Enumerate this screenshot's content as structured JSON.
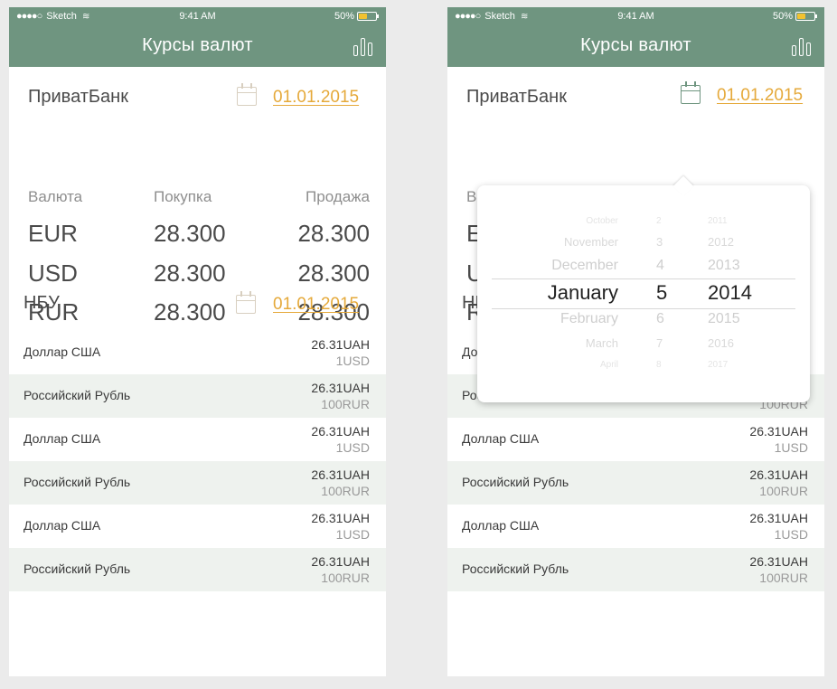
{
  "status_bar": {
    "dots": "●●●●○",
    "carrier": "Sketch",
    "wifi": "≋",
    "time": "9:41 AM",
    "battery_percent": "50%",
    "battery_level": 0.5
  },
  "header": {
    "title": "Курсы валют",
    "chart_icon": "bar-chart-icon"
  },
  "colors": {
    "header_bg": "#6f9580",
    "date_link": "#e5a93a",
    "alt_row": "#eef2ee",
    "battery": "#f2c230"
  },
  "privat": {
    "name": "ПриватБанк",
    "date": "01.01.2015",
    "calendar_icon": "calendar-icon",
    "columns": [
      "Валюта",
      "Покупка",
      "Продажа"
    ],
    "rows": [
      {
        "currency": "EUR",
        "buy": "28.300",
        "sell": "28.300"
      },
      {
        "currency": "USD",
        "buy": "28.300",
        "sell": "28.300"
      },
      {
        "currency": "RUR",
        "buy": "28.300",
        "sell": "28.300"
      }
    ]
  },
  "nbu": {
    "name": "НБУ",
    "date": "01.01.2015",
    "rows": [
      {
        "name": "Доллар США",
        "rate": "26.31UAH",
        "unit": "1USD"
      },
      {
        "name": "Российский Рубль",
        "rate": "26.31UAH",
        "unit": "100RUR"
      },
      {
        "name": "Доллар США",
        "rate": "26.31UAH",
        "unit": "1USD"
      },
      {
        "name": "Российский Рубль",
        "rate": "26.31UAH",
        "unit": "100RUR"
      },
      {
        "name": "Доллар США",
        "rate": "26.31UAH",
        "unit": "1USD"
      },
      {
        "name": "Российский Рубль",
        "rate": "26.31UAH",
        "unit": "100RUR"
      }
    ]
  },
  "picker": {
    "rows": [
      {
        "month": "October",
        "day": "2",
        "year": "2011"
      },
      {
        "month": "November",
        "day": "3",
        "year": "2012"
      },
      {
        "month": "December",
        "day": "4",
        "year": "2013"
      },
      {
        "month": "January",
        "day": "5",
        "year": "2014",
        "selected": true
      },
      {
        "month": "February",
        "day": "6",
        "year": "2015"
      },
      {
        "month": "March",
        "day": "7",
        "year": "2016"
      },
      {
        "month": "April",
        "day": "8",
        "year": "2017"
      }
    ]
  }
}
